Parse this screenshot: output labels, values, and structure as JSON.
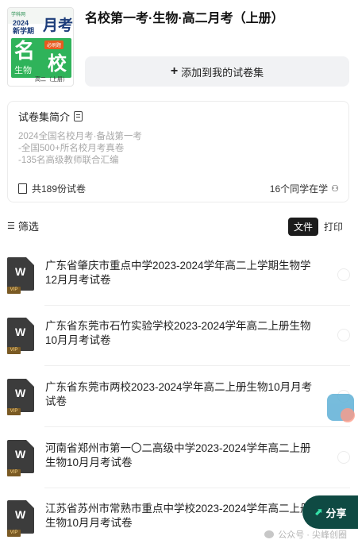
{
  "cover": {
    "brand": "学科网",
    "year": "2024\n新学期",
    "big": "月考",
    "tag": "必刷题",
    "ming": "名",
    "xiao": "校",
    "subject": "生物",
    "grade": "高二（上册）"
  },
  "header": {
    "title": "名校第一考·生物·高二月考（上册）",
    "add_label": "添加到我的试卷集"
  },
  "intro": {
    "heading": "试卷集简介",
    "lines": [
      "2024全国名校月考·备战第一考",
      "-全国500+所名校月考真卷",
      "-135名高级教师联合汇编"
    ],
    "total": "共189份试卷",
    "learning": "16个同学在学"
  },
  "filter": {
    "label": "筛选",
    "tab_file": "文件",
    "tab_print": "打印"
  },
  "items": [
    {
      "title": "广东省肇庆市重点中学2023-2024学年高二上学期生物学12月月考试卷",
      "vip": "VIP"
    },
    {
      "title": "广东省东莞市石竹实验学校2023-2024学年高二上册生物10月月考试卷",
      "vip": "VIP"
    },
    {
      "title": "广东省东莞市两校2023-2024学年高二上册生物10月月考试卷",
      "vip": "VIP"
    },
    {
      "title": "河南省郑州市第一〇二高级中学2023-2024学年高二上册生物10月月考试卷",
      "vip": "VIP"
    },
    {
      "title": "江苏省苏州市常熟市重点中学校2023-2024学年高二上册生物10月月考试卷",
      "vip": "VIP"
    }
  ],
  "share_label": "分享",
  "watermark": "公众号 · 尖峰创圈"
}
